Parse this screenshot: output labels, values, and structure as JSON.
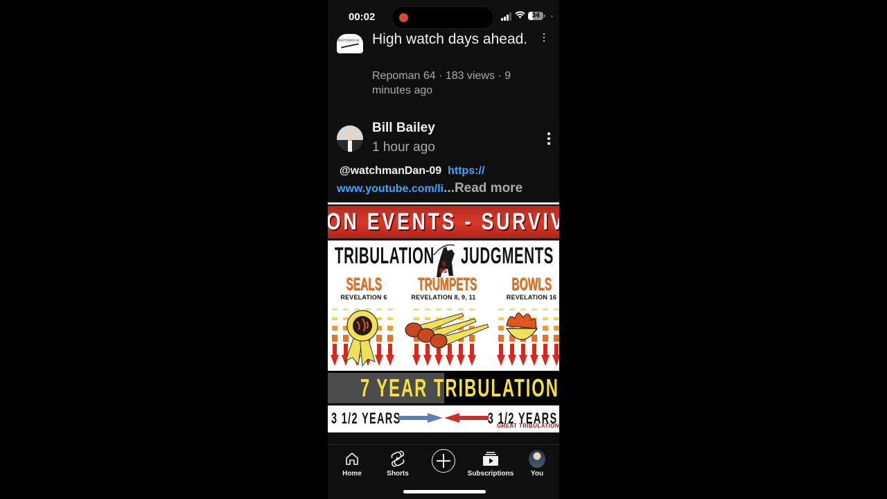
{
  "status_bar": {
    "time": "00:02",
    "recording": true,
    "battery_percent": 34,
    "battery_label": "34"
  },
  "video": {
    "title": "High watch days ahead.",
    "channel": "Repoman 64",
    "views": "183 views",
    "age": "9 minutes ago",
    "meta": "Repoman 64 · 183 views · 9 minutes ago",
    "channel_thumb_label": "REPOMAN 64"
  },
  "comment": {
    "author": "Bill Bailey",
    "time": "1 hour ago",
    "mention": "@watchmanDan-09",
    "link": "https://www.youtube.com/li",
    "link_line1": "https://",
    "link_line2": "www.youtube.com/li",
    "ellipsis": "...",
    "read_more": "Read more"
  },
  "image": {
    "banner": "ON   EVENTS - SURVIV",
    "left_title": "TRIBULATION",
    "right_title": "JUDGMENTS",
    "rider_mark": "666",
    "columns": [
      {
        "heading": "SEALS",
        "reference": "REVELATION 6"
      },
      {
        "heading": "TRUMPETS",
        "reference": "REVELATION 8, 9, 11"
      },
      {
        "heading": "BOWLS",
        "reference": "REVELATION 16"
      }
    ],
    "tribulation_bar": "7 YEAR TRIBULATION",
    "years_left": "3 1/2 YEARS",
    "years_right": "3 1/2 YEARS",
    "great_tribulation": "GREAT TRIBULATION"
  },
  "nav": {
    "items": [
      {
        "label": "Home",
        "icon": "home-icon"
      },
      {
        "label": "Shorts",
        "icon": "shorts-icon"
      },
      {
        "label": "",
        "icon": "create-plus-icon"
      },
      {
        "label": "Subscriptions",
        "icon": "subscriptions-icon"
      },
      {
        "label": "You",
        "icon": "avatar"
      }
    ]
  },
  "colors": {
    "background": "#0f0f0f",
    "link": "#3ea6ff",
    "secondary_text": "#aaaaaa",
    "record": "#d9463b"
  }
}
